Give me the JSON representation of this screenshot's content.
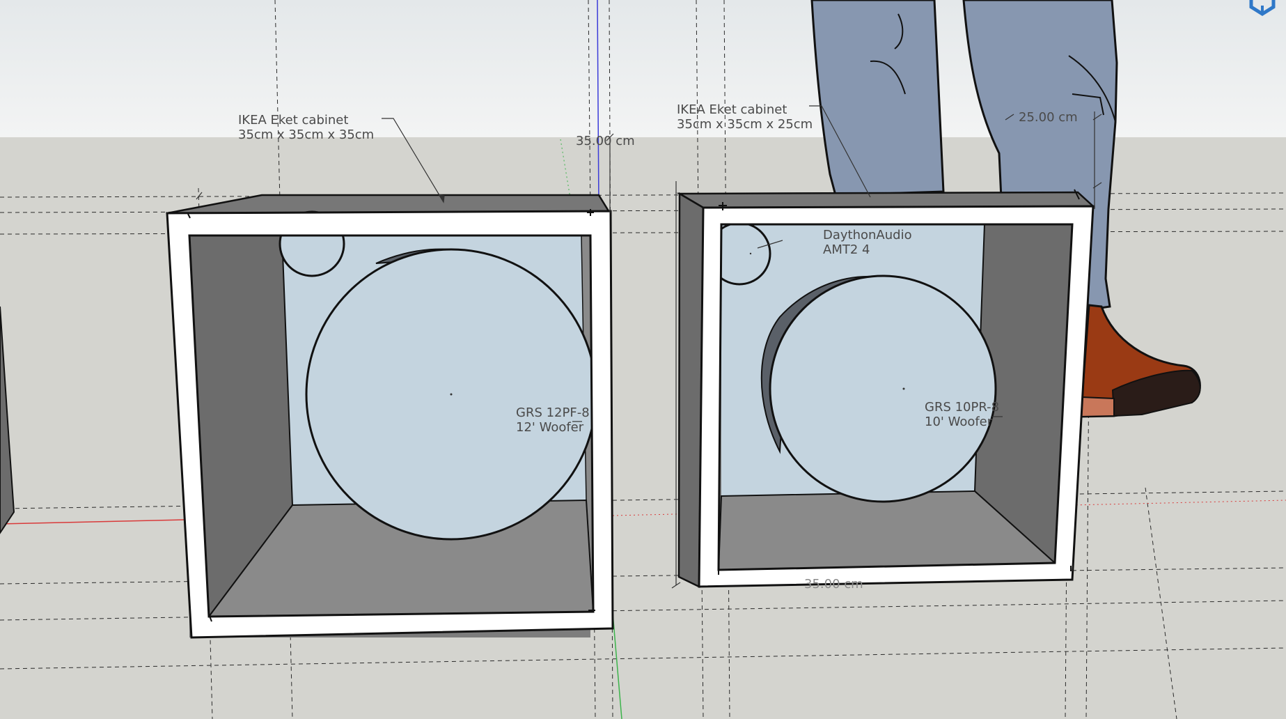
{
  "app": {
    "name": "3D modeling viewport"
  },
  "labels": {
    "left_cabinet": {
      "line1": "IKEA Eket cabinet",
      "line2": "35cm x 35cm x 35cm"
    },
    "right_cabinet": {
      "line1": "IKEA Eket cabinet",
      "line2": "35cm x 35cm x 25cm"
    },
    "left_woofer": {
      "line1": "GRS 12PF-8",
      "line2": "12' Woofer"
    },
    "right_woofer": {
      "line1": "GRS 10PR-8",
      "line2": "10'  Woofer"
    },
    "tweeter": {
      "line1": "DaythonAudio",
      "line2": "AMT2 4"
    }
  },
  "dimensions": {
    "height": "35.00 cm",
    "depth": "25.00 cm",
    "width": "35.00 cm"
  },
  "colors": {
    "sky": "#eef0f1",
    "ground": "#d4d4cf",
    "cabinet_interior": "#7d7d7d",
    "cabinet_side": "#6c6c6c",
    "cabinet_floor": "#8a8a8a",
    "baffle": "#c4d4df",
    "woofer_shadow": "#5a6068",
    "edge": "#111111",
    "frame": "#ffffff",
    "jeans": "#8797b0",
    "shoe": "#9a3a14",
    "shoe_tip": "#2a1c18",
    "axis_red": "#d93a3a",
    "axis_green": "#3cb44b",
    "axis_blue": "#3b3bd9",
    "nav_icon": "#2f78c8"
  }
}
